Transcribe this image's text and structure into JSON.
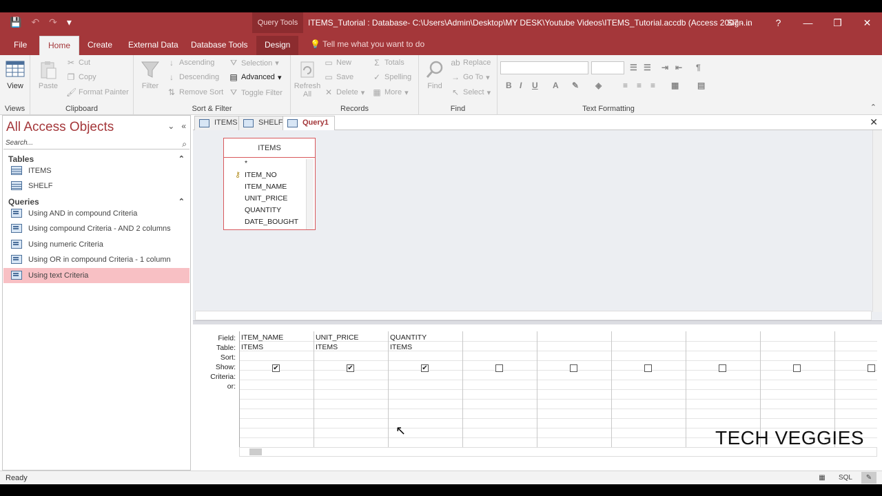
{
  "titlebar": {
    "context_tab": "Query Tools",
    "title": "ITEMS_Tutorial : Database- C:\\Users\\Admin\\Desktop\\MY DESK\\Youtube Videos\\ITEMS_Tutorial.accdb (Access 2007 -...",
    "sign_in": "Sign in",
    "help": "?",
    "minimize": "—",
    "restore": "❐",
    "close": "✕"
  },
  "tabs": [
    {
      "label": "File"
    },
    {
      "label": "Home"
    },
    {
      "label": "Create"
    },
    {
      "label": "External Data"
    },
    {
      "label": "Database Tools"
    },
    {
      "label": "Design"
    }
  ],
  "tell_me": "Tell me what you want to do",
  "ribbon": {
    "views": {
      "label": "Views",
      "view": "View"
    },
    "clipboard": {
      "label": "Clipboard",
      "paste": "Paste",
      "cut": "Cut",
      "copy": "Copy",
      "format_painter": "Format Painter"
    },
    "sort_filter": {
      "label": "Sort & Filter",
      "filter": "Filter",
      "ascending": "Ascending",
      "descending": "Descending",
      "remove_sort": "Remove Sort",
      "selection": "Selection",
      "advanced": "Advanced",
      "toggle_filter": "Toggle Filter"
    },
    "records": {
      "label": "Records",
      "refresh": "Refresh",
      "refresh_all": "All",
      "new": "New",
      "save": "Save",
      "delete": "Delete",
      "totals": "Totals",
      "spelling": "Spelling",
      "more": "More"
    },
    "find": {
      "label": "Find",
      "find": "Find",
      "replace": "Replace",
      "go_to": "Go To",
      "select": "Select"
    },
    "text_formatting": {
      "label": "Text Formatting",
      "bold": "B",
      "italic": "I",
      "underline": "U"
    }
  },
  "nav": {
    "title": "All Access Objects",
    "search_placeholder": "Search...",
    "tables_label": "Tables",
    "tables": [
      "ITEMS",
      "SHELF"
    ],
    "queries_label": "Queries",
    "queries": [
      "Using AND in compound Criteria",
      "Using compound Criteria - AND 2 columns",
      "Using numeric Criteria",
      "Using OR in compound Criteria - 1 column",
      "Using text Criteria"
    ],
    "selected_query": "Using text Criteria"
  },
  "doc_tabs": [
    "ITEMS",
    "SHELF",
    "Query1"
  ],
  "table_box": {
    "name": "ITEMS",
    "fields": [
      "*",
      "ITEM_NO",
      "ITEM_NAME",
      "UNIT_PRICE",
      "QUANTITY",
      "DATE_BOUGHT"
    ]
  },
  "grid": {
    "row_labels": [
      "Field:",
      "Table:",
      "Sort:",
      "Show:",
      "Criteria:",
      "or:"
    ],
    "columns": [
      {
        "field": "ITEM_NAME",
        "table": "ITEMS",
        "show": true
      },
      {
        "field": "UNIT_PRICE",
        "table": "ITEMS",
        "show": true
      },
      {
        "field": "QUANTITY",
        "table": "ITEMS",
        "show": true
      },
      {
        "field": "",
        "table": "",
        "show": false
      },
      {
        "field": "",
        "table": "",
        "show": false
      },
      {
        "field": "",
        "table": "",
        "show": false
      },
      {
        "field": "",
        "table": "",
        "show": false
      },
      {
        "field": "",
        "table": "",
        "show": false
      },
      {
        "field": "",
        "table": "",
        "show": false
      }
    ]
  },
  "watermark": "TECH VEGGIES",
  "status": {
    "text": "Ready",
    "view_sql": "SQL"
  },
  "colors": {
    "accent": "#a4373a",
    "selected": "#f8c0c4"
  }
}
